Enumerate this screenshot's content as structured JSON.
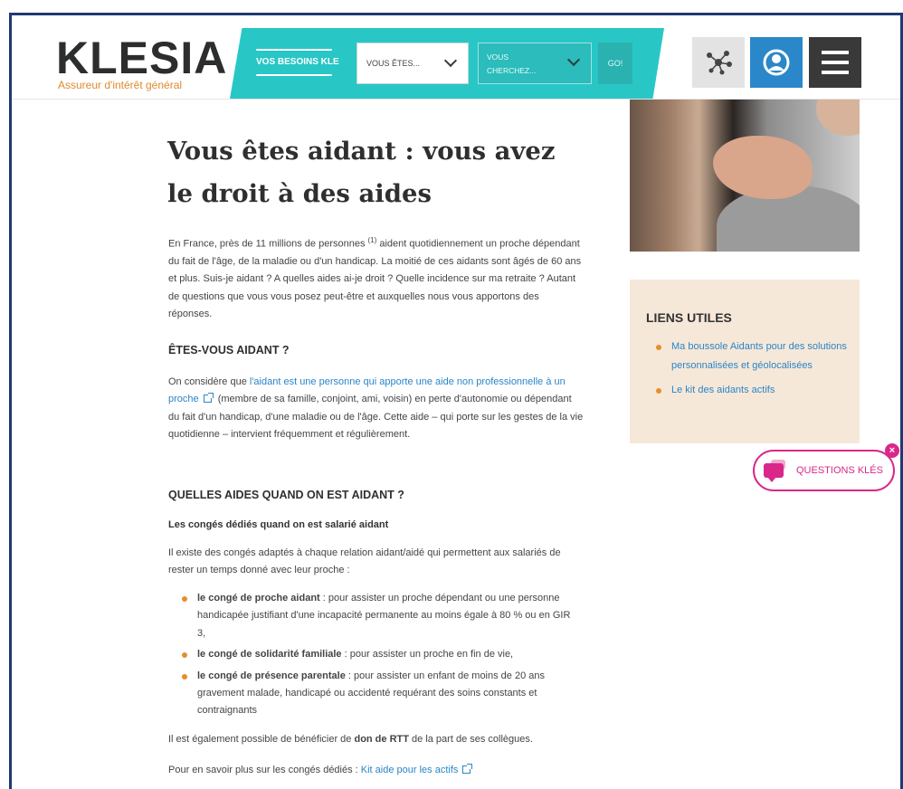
{
  "brand": {
    "name": "KLESIA",
    "tagline": "Assureur d'intérêt général"
  },
  "nav": {
    "band_label": "VOS BESOINS KLE",
    "select_who": {
      "value": "VOUS ÊTES..."
    },
    "select_what": {
      "value": "VOUS CHERCHEZ..."
    },
    "go_label": "GO!",
    "icons": [
      "network-icon",
      "user-icon",
      "hamburger-menu-icon"
    ]
  },
  "article": {
    "title": "Vous êtes aidant : vous avez le droit à des aides",
    "intro_pre": "En France, près de 11 millions de personnes ",
    "intro_note": "(1)",
    "intro_post": " aident quotidiennement un proche dépendant du fait de l'âge, de la maladie ou d'un handicap. La moitié de ces aidants sont âgés de 60 ans et plus. Suis-je aidant ? A quelles aides ai-je droit ? Quelle incidence sur ma retraite ? Autant de questions que vous vous posez peut-être et auxquelles nous vous apportons des réponses.",
    "section1": {
      "heading": "ÊTES-VOUS AIDANT ?",
      "text_pre": "On considère que ",
      "link": "l'aidant est une personne qui apporte une aide non professionnelle à un proche",
      "text_post": " (membre de sa famille, conjoint, ami, voisin) en perte d'autonomie ou dépendant du fait d'un handicap, d'une maladie ou de l'âge. Cette aide – qui porte sur les gestes de la vie quotidienne – intervient fréquemment et régulièrement."
    },
    "section2": {
      "heading": "QUELLES AIDES QUAND ON EST AIDANT ?",
      "subheading": "Les congés dédiés quand on est salarié aidant",
      "intro": "Il existe des congés adaptés à chaque relation aidant/aidé qui permettent aux salariés de rester un temps donné avec leur proche :",
      "items": [
        {
          "bold": "le congé de proche aidant",
          "text": " : pour assister un proche dépendant ou une personne handicapée justifiant d'une incapacité permanente au moins égale à 80 % ou en GIR 3,"
        },
        {
          "bold": "le congé de solidarité familiale",
          "text": " : pour assister un proche en fin de vie,"
        },
        {
          "bold": "le congé de présence parentale",
          "text": " : pour assister un enfant de moins de 20 ans gravement malade, handicapé ou accidenté requérant des soins constants et contraignants"
        }
      ],
      "rtt_pre": "Il est également possible de bénéficier de ",
      "rtt_bold": "don de RTT",
      "rtt_post": " de la part de ses collègues.",
      "more_pre": "Pour en savoir plus sur les congés dédiés : ",
      "more_link": "Kit aide pour les actifs"
    }
  },
  "sidebar": {
    "title": "LIENS UTILES",
    "links": [
      "Ma boussole Aidants pour des solutions personnalisées et géolocalisées",
      "Le kit des aidants actifs"
    ]
  },
  "chat": {
    "label": "QUESTIONS KLÉS",
    "close": "×"
  },
  "colors": {
    "teal": "#28c7c6",
    "orange": "#e58e2b",
    "link": "#2a85c7",
    "magenta": "#d9278a",
    "user_blue": "#2a87c9",
    "beige": "#f6e8d9"
  }
}
